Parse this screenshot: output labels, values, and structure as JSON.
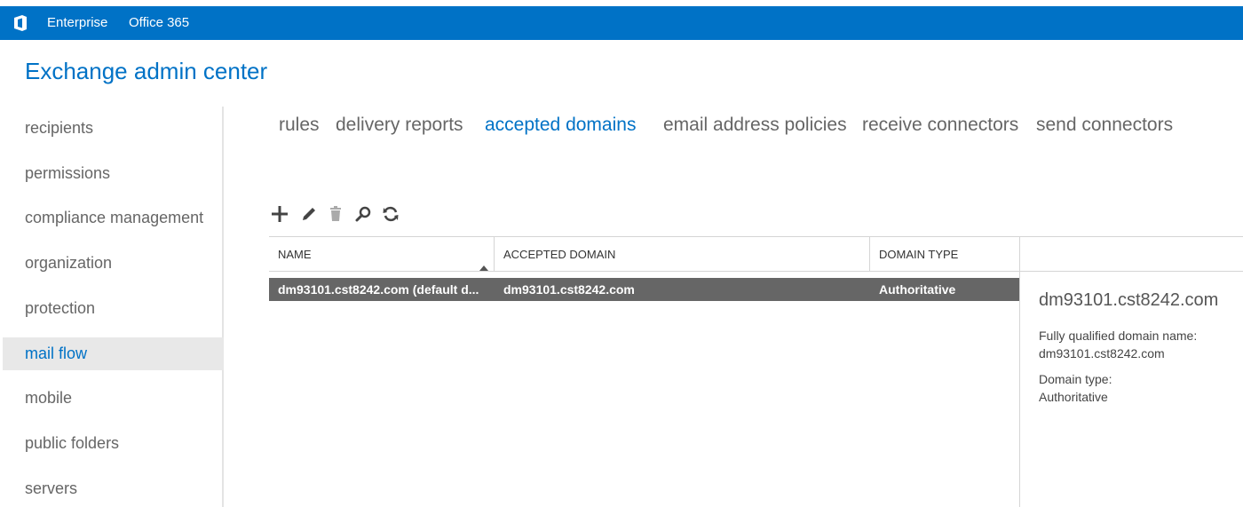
{
  "topbar": {
    "logo_icon": "office-logo-icon",
    "enterprise_label": "Enterprise",
    "office_label": "Office 365",
    "bg_color": "#0072c6"
  },
  "app": {
    "title": "Exchange admin center"
  },
  "leftnav": {
    "items": [
      {
        "label": "recipients"
      },
      {
        "label": "permissions"
      },
      {
        "label": "compliance management"
      },
      {
        "label": "organization"
      },
      {
        "label": "protection"
      },
      {
        "label": "mail flow",
        "active": true
      },
      {
        "label": "mobile"
      },
      {
        "label": "public folders"
      },
      {
        "label": "servers"
      }
    ]
  },
  "tabs": {
    "items": [
      {
        "label": "rules"
      },
      {
        "label": "delivery reports"
      },
      {
        "label": "accepted domains",
        "active": true
      },
      {
        "label": "email address policies"
      },
      {
        "label": "receive connectors"
      },
      {
        "label": "send connectors"
      }
    ]
  },
  "toolbar": {
    "buttons": [
      "add-icon",
      "edit-icon",
      "delete-icon",
      "search-icon",
      "refresh-icon"
    ]
  },
  "grid": {
    "columns": [
      "NAME",
      "ACCEPTED DOMAIN",
      "DOMAIN TYPE"
    ],
    "sort_icon": "sort-ascending-icon",
    "rows": [
      {
        "name": "dm93101.cst8242.com (default d...",
        "accepted_domain": "dm93101.cst8242.com",
        "domain_type": "Authoritative",
        "selected": true
      }
    ]
  },
  "details": {
    "title": "dm93101.cst8242.com",
    "fqdn_label": "Fully qualified domain name:",
    "fqdn_value": "dm93101.cst8242.com",
    "type_label": "Domain type:",
    "type_value": "Authoritative"
  }
}
